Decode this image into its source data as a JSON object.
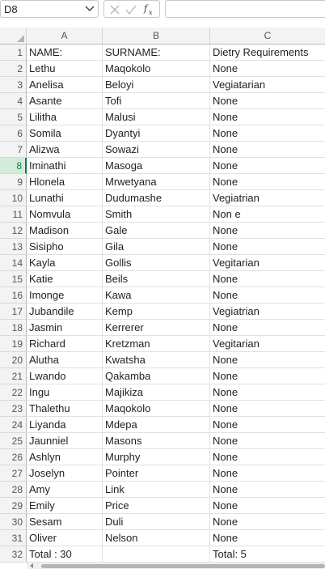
{
  "formula_bar": {
    "name_box": "D8",
    "formula": ""
  },
  "columns": [
    "A",
    "B",
    "C"
  ],
  "rows": [
    {
      "num": "1",
      "a": "NAME:",
      "b": "SURNAME:",
      "c": "Dietry Requirements"
    },
    {
      "num": "2",
      "a": "Lethu",
      "b": "Maqokolo",
      "c": "None"
    },
    {
      "num": "3",
      "a": "Anelisa",
      "b": "Beloyi",
      "c": "Vegiatarian"
    },
    {
      "num": "4",
      "a": "Asante",
      "b": "Tofi",
      "c": "None"
    },
    {
      "num": "5",
      "a": "Lilitha",
      "b": "Malusi",
      "c": "None"
    },
    {
      "num": "6",
      "a": "Somila",
      "b": "Dyantyi",
      "c": "None"
    },
    {
      "num": "7",
      "a": "Alizwa",
      "b": "Sowazi",
      "c": "None"
    },
    {
      "num": "8",
      "a": "Iminathi",
      "b": "Masoga",
      "c": "None"
    },
    {
      "num": "9",
      "a": "Hlonela",
      "b": "Mrwetyana",
      "c": "None"
    },
    {
      "num": "10",
      "a": "Lunathi",
      "b": "Dudumashe",
      "c": "Vegiatrian"
    },
    {
      "num": "11",
      "a": "Nomvula",
      "b": "Smith",
      "c": "Non e"
    },
    {
      "num": "12",
      "a": "Madison",
      "b": "Gale",
      "c": "None"
    },
    {
      "num": "13",
      "a": "Sisipho",
      "b": "Gila",
      "c": "None"
    },
    {
      "num": "14",
      "a": "Kayla",
      "b": "Gollis",
      "c": "Vegitarian"
    },
    {
      "num": "15",
      "a": "Katie",
      "b": "Beils",
      "c": "None"
    },
    {
      "num": "16",
      "a": "Imonge",
      "b": "Kawa",
      "c": "None"
    },
    {
      "num": "17",
      "a": "Jubandile",
      "b": "Kemp",
      "c": "Vegiatrian"
    },
    {
      "num": "18",
      "a": "Jasmin",
      "b": "Kerrerer",
      "c": "None"
    },
    {
      "num": "19",
      "a": "Richard",
      "b": "Kretzman",
      "c": "Vegitarian"
    },
    {
      "num": "20",
      "a": "Alutha",
      "b": "Kwatsha",
      "c": "None"
    },
    {
      "num": "21",
      "a": "Lwando",
      "b": "Qakamba",
      "c": "None"
    },
    {
      "num": "22",
      "a": "Ingu",
      "b": "Majikiza",
      "c": "None"
    },
    {
      "num": "23",
      "a": "Thalethu",
      "b": "Maqokolo",
      "c": "None"
    },
    {
      "num": "24",
      "a": "Liyanda",
      "b": "Mdepa",
      "c": "None"
    },
    {
      "num": "25",
      "a": "Jaunniel",
      "b": "Masons",
      "c": "None"
    },
    {
      "num": "26",
      "a": "Ashlyn",
      "b": "Murphy",
      "c": "None"
    },
    {
      "num": "27",
      "a": "Joselyn",
      "b": "Pointer",
      "c": "None"
    },
    {
      "num": "28",
      "a": "Amy",
      "b": "Link",
      "c": "None"
    },
    {
      "num": "29",
      "a": "Emily",
      "b": "Price",
      "c": "None"
    },
    {
      "num": "30",
      "a": "Sesam",
      "b": "Duli",
      "c": "None"
    },
    {
      "num": "31",
      "a": "Oliver",
      "b": "Nelson",
      "c": "None"
    },
    {
      "num": "32",
      "a": "Total : 30",
      "b": "",
      "c": "Total: 5"
    }
  ],
  "active_row": "8",
  "colors": {
    "accent": "#107c41",
    "header_bg": "#f3f3f3",
    "gridline": "#e1e1e1"
  },
  "icons": {
    "name_box_dropdown": "chevron-down-icon",
    "cancel": "close-icon",
    "enter": "check-icon",
    "function": "fx-icon"
  }
}
